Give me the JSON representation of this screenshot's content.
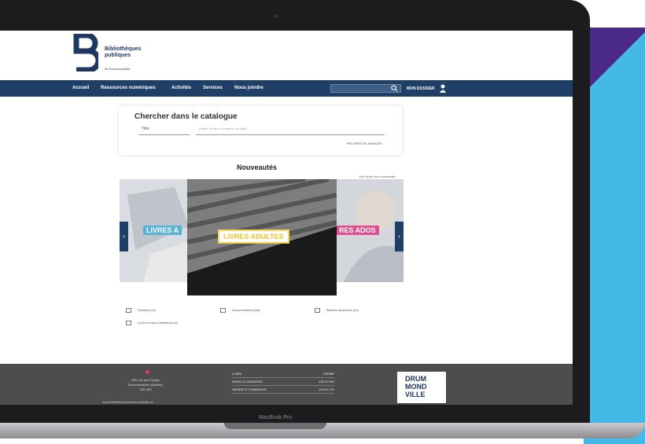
{
  "logo": {
    "title_line1": "Bibliothèques",
    "title_line2": "publiques",
    "subtitle": "de Drummondville"
  },
  "nav": {
    "items": [
      "Accueil",
      "Ressources numériques",
      "Activités",
      "Services",
      "Nous joindre"
    ],
    "login": "MON DOSSIER"
  },
  "catalog": {
    "title": "Chercher dans le catalogue",
    "select_value": "Titre",
    "input_placeholder": "Entrez un titre, un auteur, un sujet...",
    "advanced": "RECHERCHE AVANCÉE"
  },
  "news": {
    "title": "Nouveautés",
    "see_all": "Voir toutes les nouveautés"
  },
  "carousel": {
    "left_tag": "LIVRES A",
    "center_tag": "LIVRES ADULTES",
    "right_tag": "RES ADOS",
    "prev": "‹",
    "next": "›"
  },
  "categories": [
    "Romans (12)",
    "Documentaires (56)",
    "Bandes dessinées (14)",
    "Livres en gros caractères (4)"
  ],
  "footer": {
    "address_line1": "425, rue des Forges",
    "address_line2": "Drummondville (Québec)",
    "address_line3": "J2B 0E8",
    "link": "www.bibliothequesdrummondville.ca",
    "hours": [
      {
        "day": "LUNDI",
        "time": "FERMÉ"
      },
      {
        "day": "MARDI À VENDREDI",
        "time": "10H À 20H"
      },
      {
        "day": "SAMEDI ET DIMANCHE",
        "time": "10H À 17H"
      }
    ],
    "city_logo": [
      "DRUM",
      "MOND",
      "VILLE"
    ]
  },
  "device_label": "MacBook Pro"
}
